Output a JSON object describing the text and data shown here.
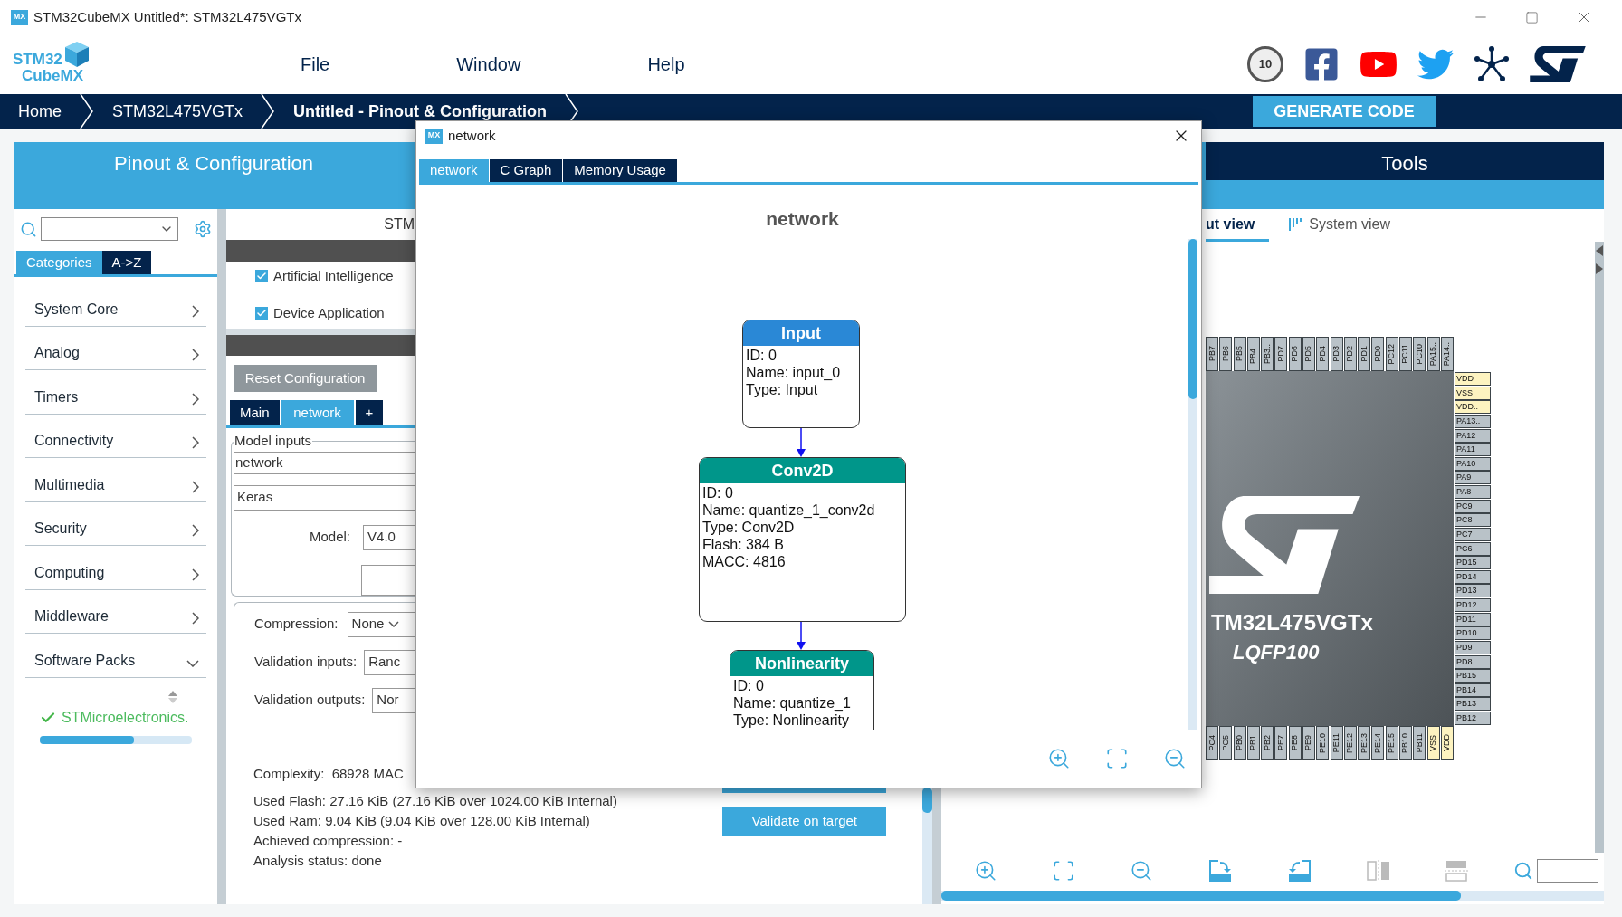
{
  "window": {
    "app_icon": "MX",
    "title": "STM32CubeMX Untitled*: STM32L475VGTx"
  },
  "logo": {
    "line_1": "STM32",
    "line_2": "CubeMX"
  },
  "menu": [
    "File",
    "Window",
    "Help"
  ],
  "badge": {
    "text": "10"
  },
  "breadcrumbs": [
    {
      "label": "Home",
      "current": false
    },
    {
      "label": "STM32L475VGTx",
      "current": false
    },
    {
      "label": "Untitled - Pinout & Configuration",
      "current": true
    }
  ],
  "generate_button": "GENERATE CODE",
  "main_tabs": [
    {
      "label": "Pinout & Configuration",
      "selected": true
    },
    {
      "label": "Tools",
      "selected": false
    }
  ],
  "sidebar": {
    "category_tabs": [
      {
        "label": "Categories",
        "selected": true
      },
      {
        "label": "A->Z",
        "selected": false
      }
    ],
    "items": [
      {
        "label": "System Core",
        "expanded": false
      },
      {
        "label": "Analog",
        "expanded": false
      },
      {
        "label": "Timers",
        "expanded": false
      },
      {
        "label": "Connectivity",
        "expanded": false
      },
      {
        "label": "Multimedia",
        "expanded": false
      },
      {
        "label": "Security",
        "expanded": false
      },
      {
        "label": "Computing",
        "expanded": false
      },
      {
        "label": "Middleware",
        "expanded": false
      },
      {
        "label": "Software Packs",
        "expanded": true
      }
    ],
    "pack": {
      "label": "STMicroelectronics.",
      "level": 0.62
    }
  },
  "middle": {
    "header": "STM",
    "components": [
      {
        "label": "Artificial Intelligence",
        "checked": true
      },
      {
        "label": "Device Application",
        "checked": true
      }
    ],
    "reset_button": {
      "label": "Reset Configuration",
      "disabled": true
    },
    "tabs": [
      {
        "label": "Main",
        "selected": false
      },
      {
        "label": "network",
        "selected": true
      },
      {
        "label": "+",
        "selected": false
      }
    ],
    "model_inputs": {
      "legend": "Model inputs",
      "name": "network",
      "framework": "Keras",
      "model_label": "Model:",
      "model_value": "V4.0"
    },
    "settings": [
      {
        "label": "Compression:",
        "value": "None",
        "kind": "select"
      },
      {
        "label": "Validation inputs:",
        "value": "Ranc",
        "kind": "field"
      },
      {
        "label": "Validation outputs:",
        "value": "Nor",
        "kind": "field"
      }
    ],
    "complexity": "Complexity:  68928 MAC",
    "stats": [
      "Used Flash: 27.16 KiB (27.16 KiB over 1024.00 KiB Internal)",
      "Used Ram: 9.04 KiB (9.04 KiB over 128.00 KiB Internal)",
      "Achieved compression: -",
      "Analysis status: done"
    ],
    "validate_button": "Validate on target"
  },
  "dialog": {
    "icon": "MX",
    "title": "network",
    "tabs": [
      {
        "label": "network",
        "selected": true
      },
      {
        "label": "C Graph",
        "selected": false
      },
      {
        "label": "Memory Usage",
        "selected": false
      }
    ],
    "heading": "network",
    "nodes": [
      {
        "title": "Input",
        "color": "#2a88d6",
        "lines": [
          "ID: 0",
          "Name: input_0",
          "Type: Input"
        ]
      },
      {
        "title": "Conv2D",
        "color": "#00968a",
        "lines": [
          "ID: 0",
          "Name: quantize_1_conv2d",
          "Type: Conv2D",
          "Flash: 384 B",
          "MACC: 4816"
        ]
      },
      {
        "title": "Nonlinearity",
        "color": "#00968a",
        "lines": [
          "ID: 0",
          "Name: quantize_1",
          "Type: Nonlinearity"
        ]
      }
    ]
  },
  "pinout": {
    "view_tabs": [
      {
        "label": "ut view",
        "selected": true
      },
      {
        "label": "System view",
        "selected": false
      }
    ],
    "chip": {
      "name": "TM32L475VGTx",
      "package": "LQFP100",
      "top_pins": [
        {
          "label": "PB7",
          "kind": "io"
        },
        {
          "label": "PB6",
          "kind": "io"
        },
        {
          "label": "PB5",
          "kind": "io"
        },
        {
          "label": "PB4..",
          "kind": "io"
        },
        {
          "label": "PB3..",
          "kind": "io"
        },
        {
          "label": "PD7",
          "kind": "io"
        },
        {
          "label": "PD6",
          "kind": "io"
        },
        {
          "label": "PD5",
          "kind": "io"
        },
        {
          "label": "PD4",
          "kind": "io"
        },
        {
          "label": "PD3",
          "kind": "io"
        },
        {
          "label": "PD2",
          "kind": "io"
        },
        {
          "label": "PD1",
          "kind": "io"
        },
        {
          "label": "PD0",
          "kind": "io"
        },
        {
          "label": "PC12",
          "kind": "io"
        },
        {
          "label": "PC11",
          "kind": "io"
        },
        {
          "label": "PC10",
          "kind": "io"
        },
        {
          "label": "PA15..",
          "kind": "io"
        },
        {
          "label": "PA14..",
          "kind": "io"
        }
      ],
      "right_pins": [
        {
          "label": "VDD",
          "kind": "power"
        },
        {
          "label": "VSS",
          "kind": "power"
        },
        {
          "label": "VDD..",
          "kind": "power"
        },
        {
          "label": "PA13..",
          "kind": "io"
        },
        {
          "label": "PA12",
          "kind": "io"
        },
        {
          "label": "PA11",
          "kind": "io"
        },
        {
          "label": "PA10",
          "kind": "io"
        },
        {
          "label": "PA9",
          "kind": "io"
        },
        {
          "label": "PA8",
          "kind": "io"
        },
        {
          "label": "PC9",
          "kind": "io"
        },
        {
          "label": "PC8",
          "kind": "io"
        },
        {
          "label": "PC7",
          "kind": "io"
        },
        {
          "label": "PC6",
          "kind": "io"
        },
        {
          "label": "PD15",
          "kind": "io"
        },
        {
          "label": "PD14",
          "kind": "io"
        },
        {
          "label": "PD13",
          "kind": "io"
        },
        {
          "label": "PD12",
          "kind": "io"
        },
        {
          "label": "PD11",
          "kind": "io"
        },
        {
          "label": "PD10",
          "kind": "io"
        },
        {
          "label": "PD9",
          "kind": "io"
        },
        {
          "label": "PD8",
          "kind": "io"
        },
        {
          "label": "PB15",
          "kind": "io"
        },
        {
          "label": "PB14",
          "kind": "io"
        },
        {
          "label": "PB13",
          "kind": "io"
        },
        {
          "label": "PB12",
          "kind": "io"
        }
      ],
      "bottom_pins": [
        {
          "label": "PC4",
          "kind": "io"
        },
        {
          "label": "PC5",
          "kind": "io"
        },
        {
          "label": "PB0",
          "kind": "io"
        },
        {
          "label": "PB1",
          "kind": "io"
        },
        {
          "label": "PB2",
          "kind": "io"
        },
        {
          "label": "PE7",
          "kind": "io"
        },
        {
          "label": "PE8",
          "kind": "io"
        },
        {
          "label": "PE9",
          "kind": "io"
        },
        {
          "label": "PE10",
          "kind": "io"
        },
        {
          "label": "PE11",
          "kind": "io"
        },
        {
          "label": "PE12",
          "kind": "io"
        },
        {
          "label": "PE13",
          "kind": "io"
        },
        {
          "label": "PE14",
          "kind": "io"
        },
        {
          "label": "PE15",
          "kind": "io"
        },
        {
          "label": "PB10",
          "kind": "io"
        },
        {
          "label": "PB11",
          "kind": "io"
        },
        {
          "label": "VSS",
          "kind": "power"
        },
        {
          "label": "VDD",
          "kind": "power"
        }
      ]
    }
  }
}
